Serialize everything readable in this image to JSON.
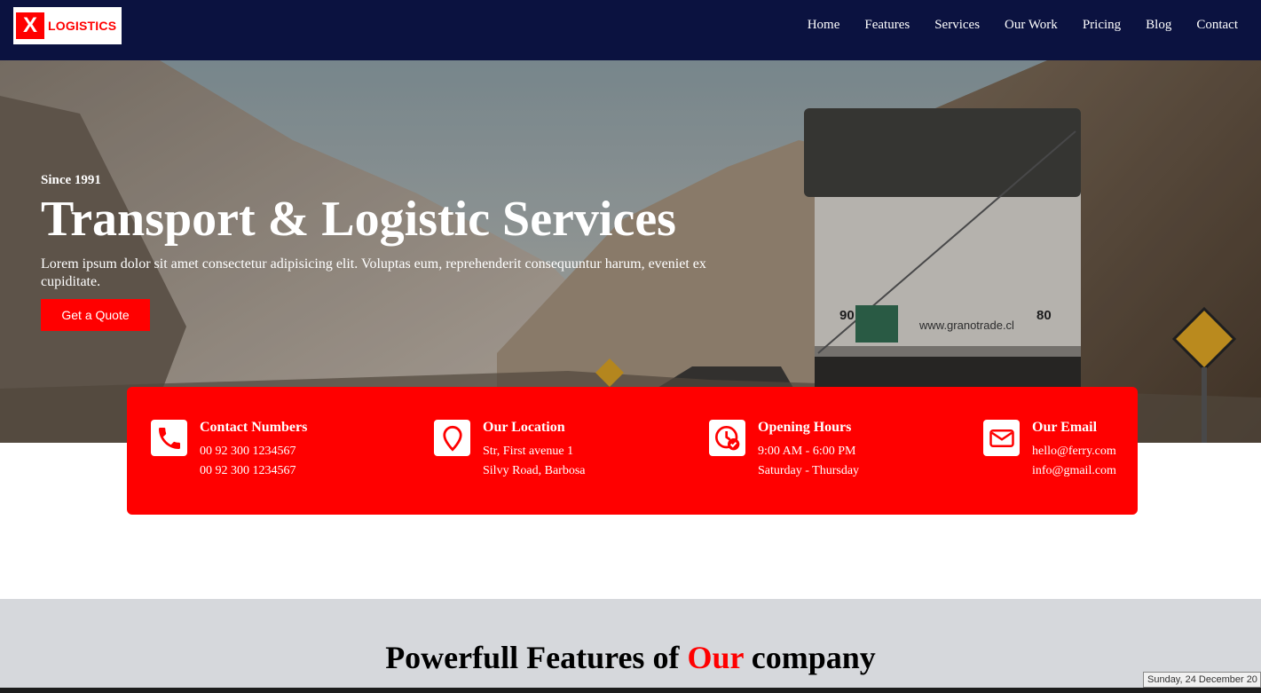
{
  "brand": {
    "logo_mark": "X",
    "logo_text": "LOGISTICS",
    "colors": {
      "primary": "#ff0000",
      "navbar": "#0b1240"
    }
  },
  "nav": {
    "items": [
      "Home",
      "Features",
      "Services",
      "Our Work",
      "Pricing",
      "Blog",
      "Contact"
    ]
  },
  "hero": {
    "eyebrow": "Since 1991",
    "title": "Transport & Logistic Services",
    "description": "Lorem ipsum dolor sit amet consectetur adipisicing elit. Voluptas eum, reprehenderit consequuntur harum, eveniet ex cupiditate.",
    "cta": "Get a Quote"
  },
  "info": [
    {
      "icon": "phone-icon",
      "title": "Contact Numbers",
      "lines": [
        "00 92 300 1234567",
        "00 92 300 1234567"
      ]
    },
    {
      "icon": "location-pin-icon",
      "title": "Our Location",
      "lines": [
        "Str, First avenue 1",
        "Silvy Road, Barbosa"
      ]
    },
    {
      "icon": "clock-icon",
      "title": "Opening Hours",
      "lines": [
        "9:00 AM - 6:00 PM",
        "Saturday - Thursday"
      ]
    },
    {
      "icon": "mail-icon",
      "title": "Our Email",
      "lines": [
        "hello@ferry.com",
        "info@gmail.com"
      ]
    }
  ],
  "features": {
    "title_before": "Powerfull Features of ",
    "title_accent": "Our",
    "title_after": " company"
  },
  "taskbar": {
    "date": "Sunday, 24 December 20"
  }
}
